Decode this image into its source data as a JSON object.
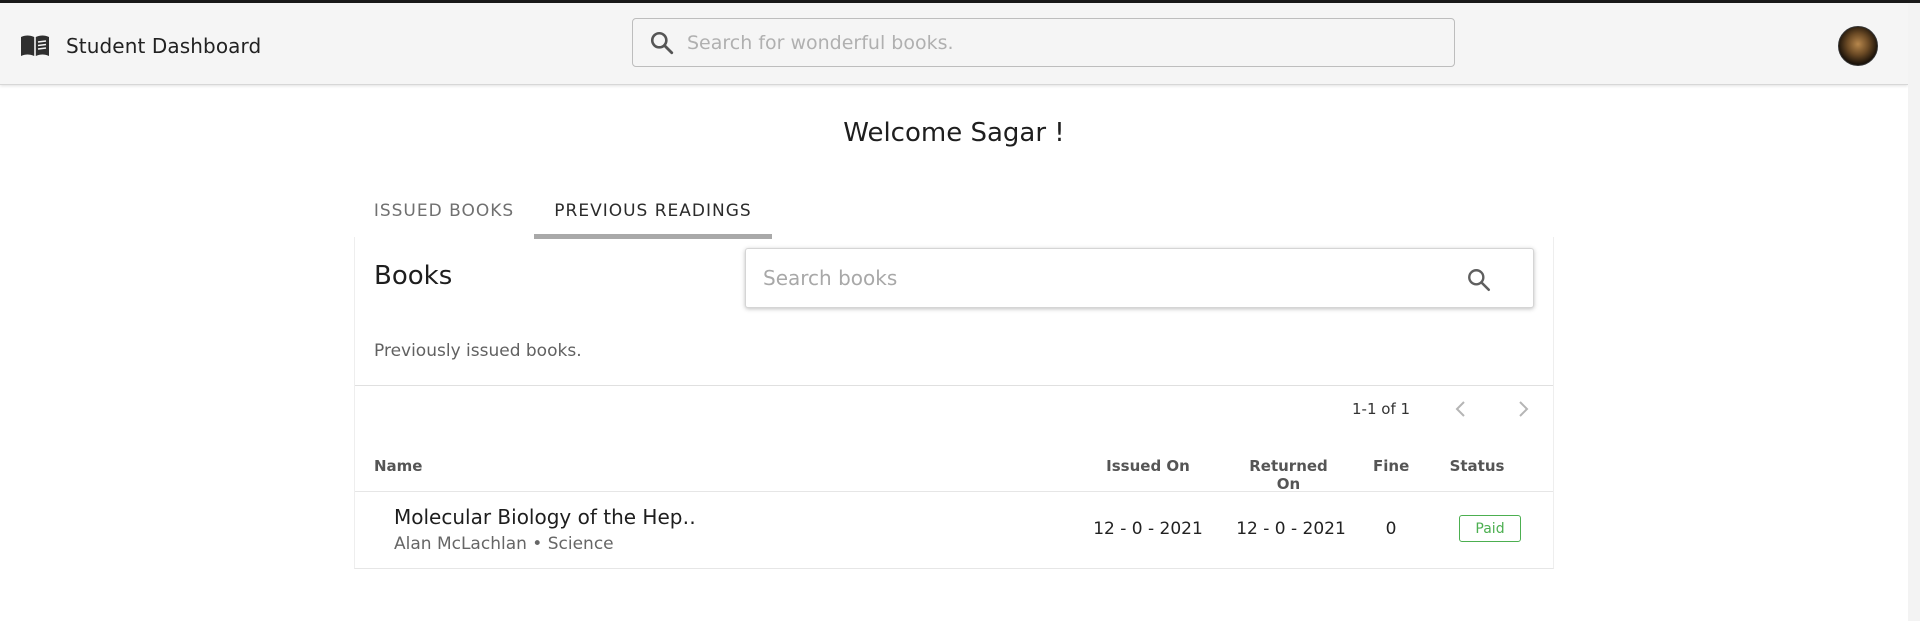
{
  "app": {
    "title": "Student Dashboard",
    "brand_icon": "book-open-icon",
    "search_placeholder": "Search for wonderful books.",
    "avatar_icon": "user-avatar"
  },
  "welcome": "Welcome Sagar !",
  "tabs": [
    {
      "label": "ISSUED BOOKS",
      "active": false
    },
    {
      "label": "PREVIOUS READINGS",
      "active": true
    }
  ],
  "books_card": {
    "title": "Books",
    "search_placeholder": "Search books",
    "subtitle": "Previously issued books.",
    "pagination": {
      "range": "1-1 of 1"
    },
    "columns": [
      "Name",
      "Issued On",
      "Returned On",
      "Fine",
      "Status"
    ],
    "rows": [
      {
        "title": "Molecular Biology of the Hep…",
        "meta": "Alan McLachlan • Science",
        "issued_on": "12 - 0 - 2021",
        "returned_on": "12 - 0 - 2021",
        "fine": "0",
        "status": "Paid"
      }
    ]
  },
  "colors": {
    "appbar_bg": "#f5f5f5",
    "status_paid": "#4caf50",
    "tab_indicator": "#a9a9a9"
  }
}
